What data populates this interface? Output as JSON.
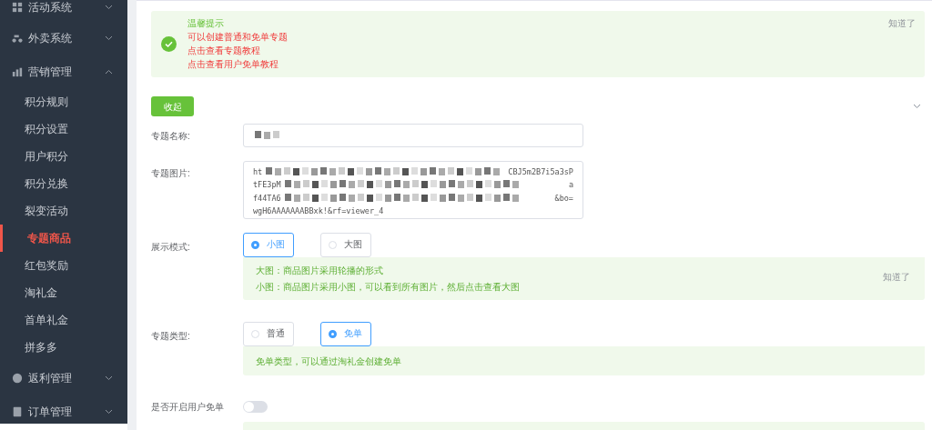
{
  "sidebar": {
    "items": [
      {
        "label": "活动系统",
        "expanded": false
      },
      {
        "label": "外卖系统",
        "expanded": false
      },
      {
        "label": "营销管理",
        "expanded": true,
        "children": [
          {
            "label": "积分规则",
            "selected": false
          },
          {
            "label": "积分设置",
            "selected": false
          },
          {
            "label": "用户积分",
            "selected": false
          },
          {
            "label": "积分兑换",
            "selected": false
          },
          {
            "label": "裂变活动",
            "selected": false
          },
          {
            "label": "专题商品",
            "selected": true
          },
          {
            "label": "红包奖励",
            "selected": false
          },
          {
            "label": "淘礼金",
            "selected": false
          },
          {
            "label": "首单礼金",
            "selected": false
          },
          {
            "label": "拼多多",
            "selected": false
          }
        ]
      },
      {
        "label": "返利管理",
        "expanded": false
      },
      {
        "label": "订单管理",
        "expanded": false
      }
    ]
  },
  "notice": {
    "title": "温馨提示",
    "lines": [
      "可以创建普通和免单专题",
      "点击查看专题教程",
      "点击查看用户免单教程"
    ],
    "dismiss": "知道了"
  },
  "collapse_button": "收起",
  "form": {
    "name": {
      "label": "专题名称:"
    },
    "image": {
      "label": "专题图片:",
      "lines": [
        [
          "ht",
          "CBJ5m2B7i5a3sP"
        ],
        [
          "tFE3pM",
          "a"
        ],
        [
          "f44TA6",
          "&bo="
        ],
        [
          "wgH6AAAAAAABBxk!&rf=viewer_4"
        ]
      ]
    },
    "display_mode": {
      "label": "展示模式:",
      "options": [
        {
          "label": "小图",
          "selected": true
        },
        {
          "label": "大图",
          "selected": false
        }
      ],
      "hint": [
        "大图：商品图片采用轮播的形式",
        "小图：商品图片采用小图，可以看到所有图片，然后点击查看大图"
      ],
      "dismiss": "知道了"
    },
    "topic_type": {
      "label": "专题类型:",
      "options": [
        {
          "label": "普通",
          "selected": false
        },
        {
          "label": "免单",
          "selected": true
        }
      ],
      "hint": [
        "免单类型，可以通过淘礼金创建免单"
      ]
    },
    "user_free": {
      "label": "是否开启用户免单",
      "on": false
    }
  }
}
